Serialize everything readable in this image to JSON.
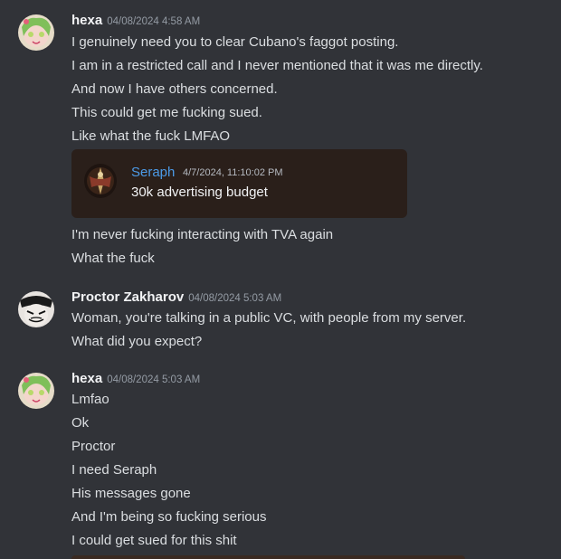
{
  "messages": [
    {
      "author": "hexa",
      "timestamp": "04/08/2024 4:58 AM",
      "lines": [
        "I genuinely need you to clear Cubano's faggot posting.",
        "I am in a restricted call and I never mentioned that it was me directly.",
        "And now I have others concerned.",
        "This could get me fucking sued.",
        "Like what the fuck LMFAO"
      ],
      "embed": {
        "author": "Seraph",
        "timestamp": "4/7/2024, 11:10:02 PM",
        "text": "30k advertising budget"
      },
      "lines_after": [
        "I'm never fucking interacting with TVA again",
        "What the fuck"
      ]
    },
    {
      "author": "Proctor Zakharov",
      "timestamp": "04/08/2024 5:03 AM",
      "lines": [
        "Woman, you're talking in a public VC, with people from my server.",
        "What did you expect?"
      ]
    },
    {
      "author": "hexa",
      "timestamp": "04/08/2024 5:03 AM",
      "lines": [
        "Lmfao",
        "Ok",
        "Proctor",
        "I need Seraph",
        "His messages gone",
        "And I'm being so fucking serious",
        "I could get sued for this shit"
      ]
    }
  ],
  "colors": {
    "background": "#313338",
    "author": "#f2f3f5",
    "timestamp": "#949ba4",
    "embed_author": "#4c9be8",
    "embed_background": "#2a1f1a"
  },
  "icons": {
    "hexa_avatar": "anime-girl-avatar",
    "proctor_avatar": "masked-character-avatar",
    "seraph_avatar": "angel-figure-avatar"
  }
}
